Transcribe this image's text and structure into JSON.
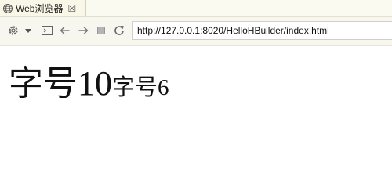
{
  "tab": {
    "title": "Web浏览器",
    "close_symbol": "☒",
    "icon": "globe-icon"
  },
  "toolbar": {
    "icons": [
      "gear-icon",
      "dropdown-icon",
      "console-icon",
      "back-icon",
      "forward-icon",
      "stop-icon",
      "refresh-icon"
    ],
    "address": "http://127.0.0.1:8020/HelloHBuilder/index.html"
  },
  "content": {
    "text_large": "字号10",
    "text_small": "字号6"
  }
}
